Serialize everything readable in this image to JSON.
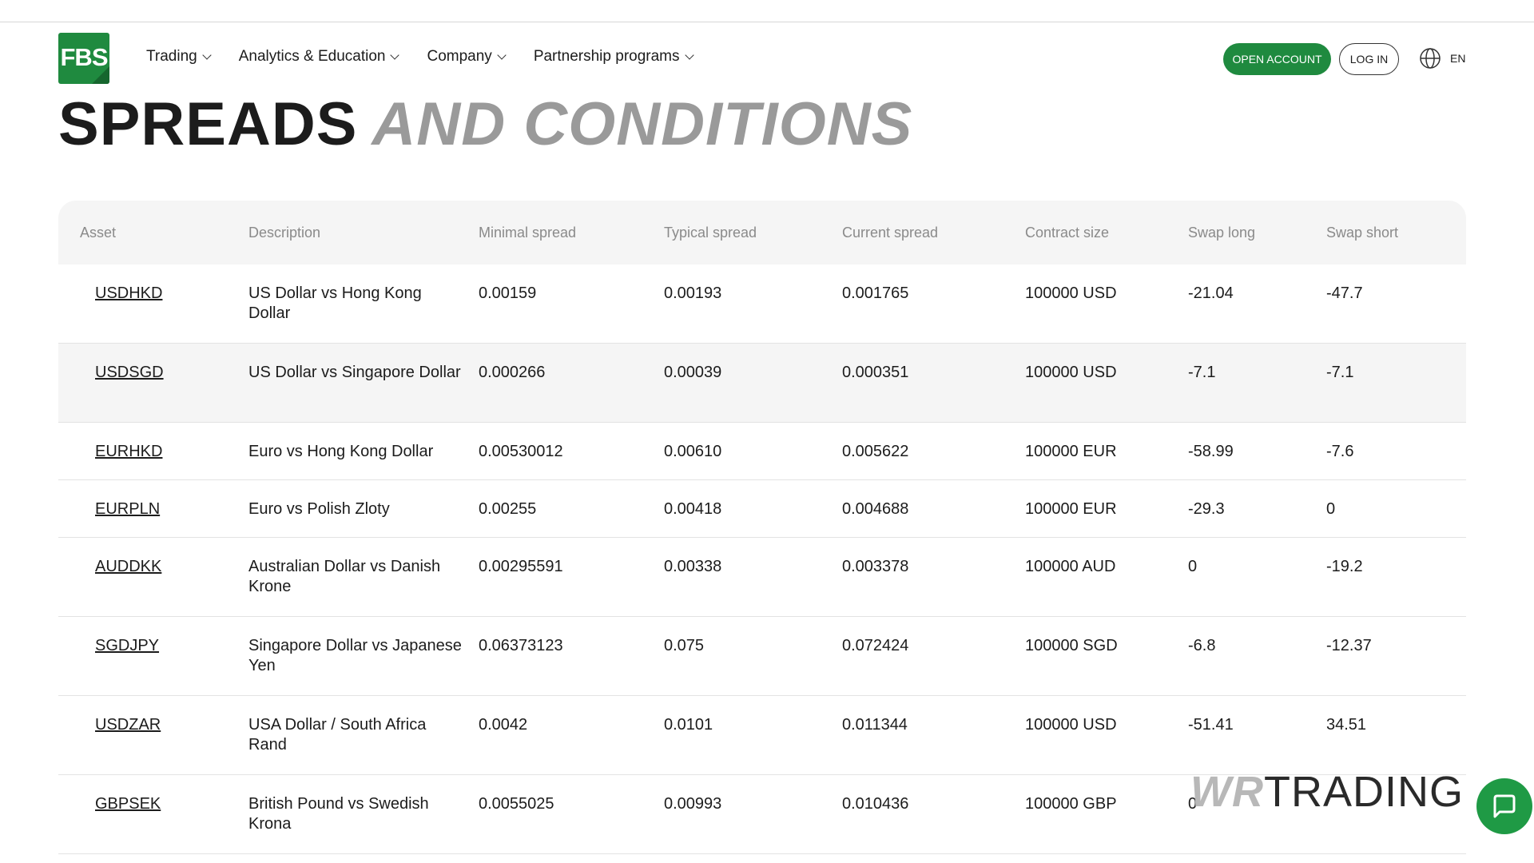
{
  "header": {
    "logo_text": "FBS",
    "nav": [
      {
        "label": "Trading"
      },
      {
        "label": "Analytics & Education"
      },
      {
        "label": "Company"
      },
      {
        "label": "Partnership programs"
      }
    ],
    "open_account": "OPEN ACCOUNT",
    "log_in": "LOG IN",
    "language": "EN"
  },
  "title": {
    "part1": "SPREADS",
    "part2": "AND CONDITIONS"
  },
  "table": {
    "columns": [
      "Asset",
      "Description",
      "Minimal spread",
      "Typical spread",
      "Current spread",
      "Contract size",
      "Swap long",
      "Swap short"
    ],
    "rows": [
      [
        "USDHKD",
        "US Dollar vs Hong Kong Dollar",
        "0.00159",
        "0.00193",
        "0.001765",
        "100000 USD",
        "-21.04",
        "-47.7"
      ],
      [
        "USDSGD",
        "US Dollar vs Singapore Dollar",
        "0.000266",
        "0.00039",
        "0.000351",
        "100000 USD",
        "-7.1",
        "-7.1"
      ],
      [
        "EURHKD",
        "Euro vs Hong Kong Dollar",
        "0.00530012",
        "0.00610",
        "0.005622",
        "100000 EUR",
        "-58.99",
        "-7.6"
      ],
      [
        "EURPLN",
        "Euro vs Polish Zloty",
        "0.00255",
        "0.00418",
        "0.004688",
        "100000 EUR",
        "-29.3",
        "0"
      ],
      [
        "AUDDKK",
        "Australian Dollar vs Danish Krone",
        "0.00295591",
        "0.00338",
        "0.003378",
        "100000 AUD",
        "0",
        "-19.2"
      ],
      [
        "SGDJPY",
        "Singapore Dollar vs Japanese Yen",
        "0.06373123",
        "0.075",
        "0.072424",
        "100000 SGD",
        "-6.8",
        "-12.37"
      ],
      [
        "USDZAR",
        "USA Dollar / South Africa Rand",
        "0.0042",
        "0.0101",
        "0.011344",
        "100000 USD",
        "-51.41",
        "34.51"
      ],
      [
        "GBPSEK",
        "British Pound vs Swedish Krona",
        "0.0055025",
        "0.00993",
        "0.010436",
        "100000 GBP",
        "0",
        ""
      ]
    ],
    "highlighted_row": 1
  },
  "watermark": {
    "part1": "WR",
    "part2": "TRADING"
  },
  "colors": {
    "brand_green": "#1f8a3f",
    "header_bg": "#f5f5f5",
    "title_grey": "#9a9a9a"
  }
}
